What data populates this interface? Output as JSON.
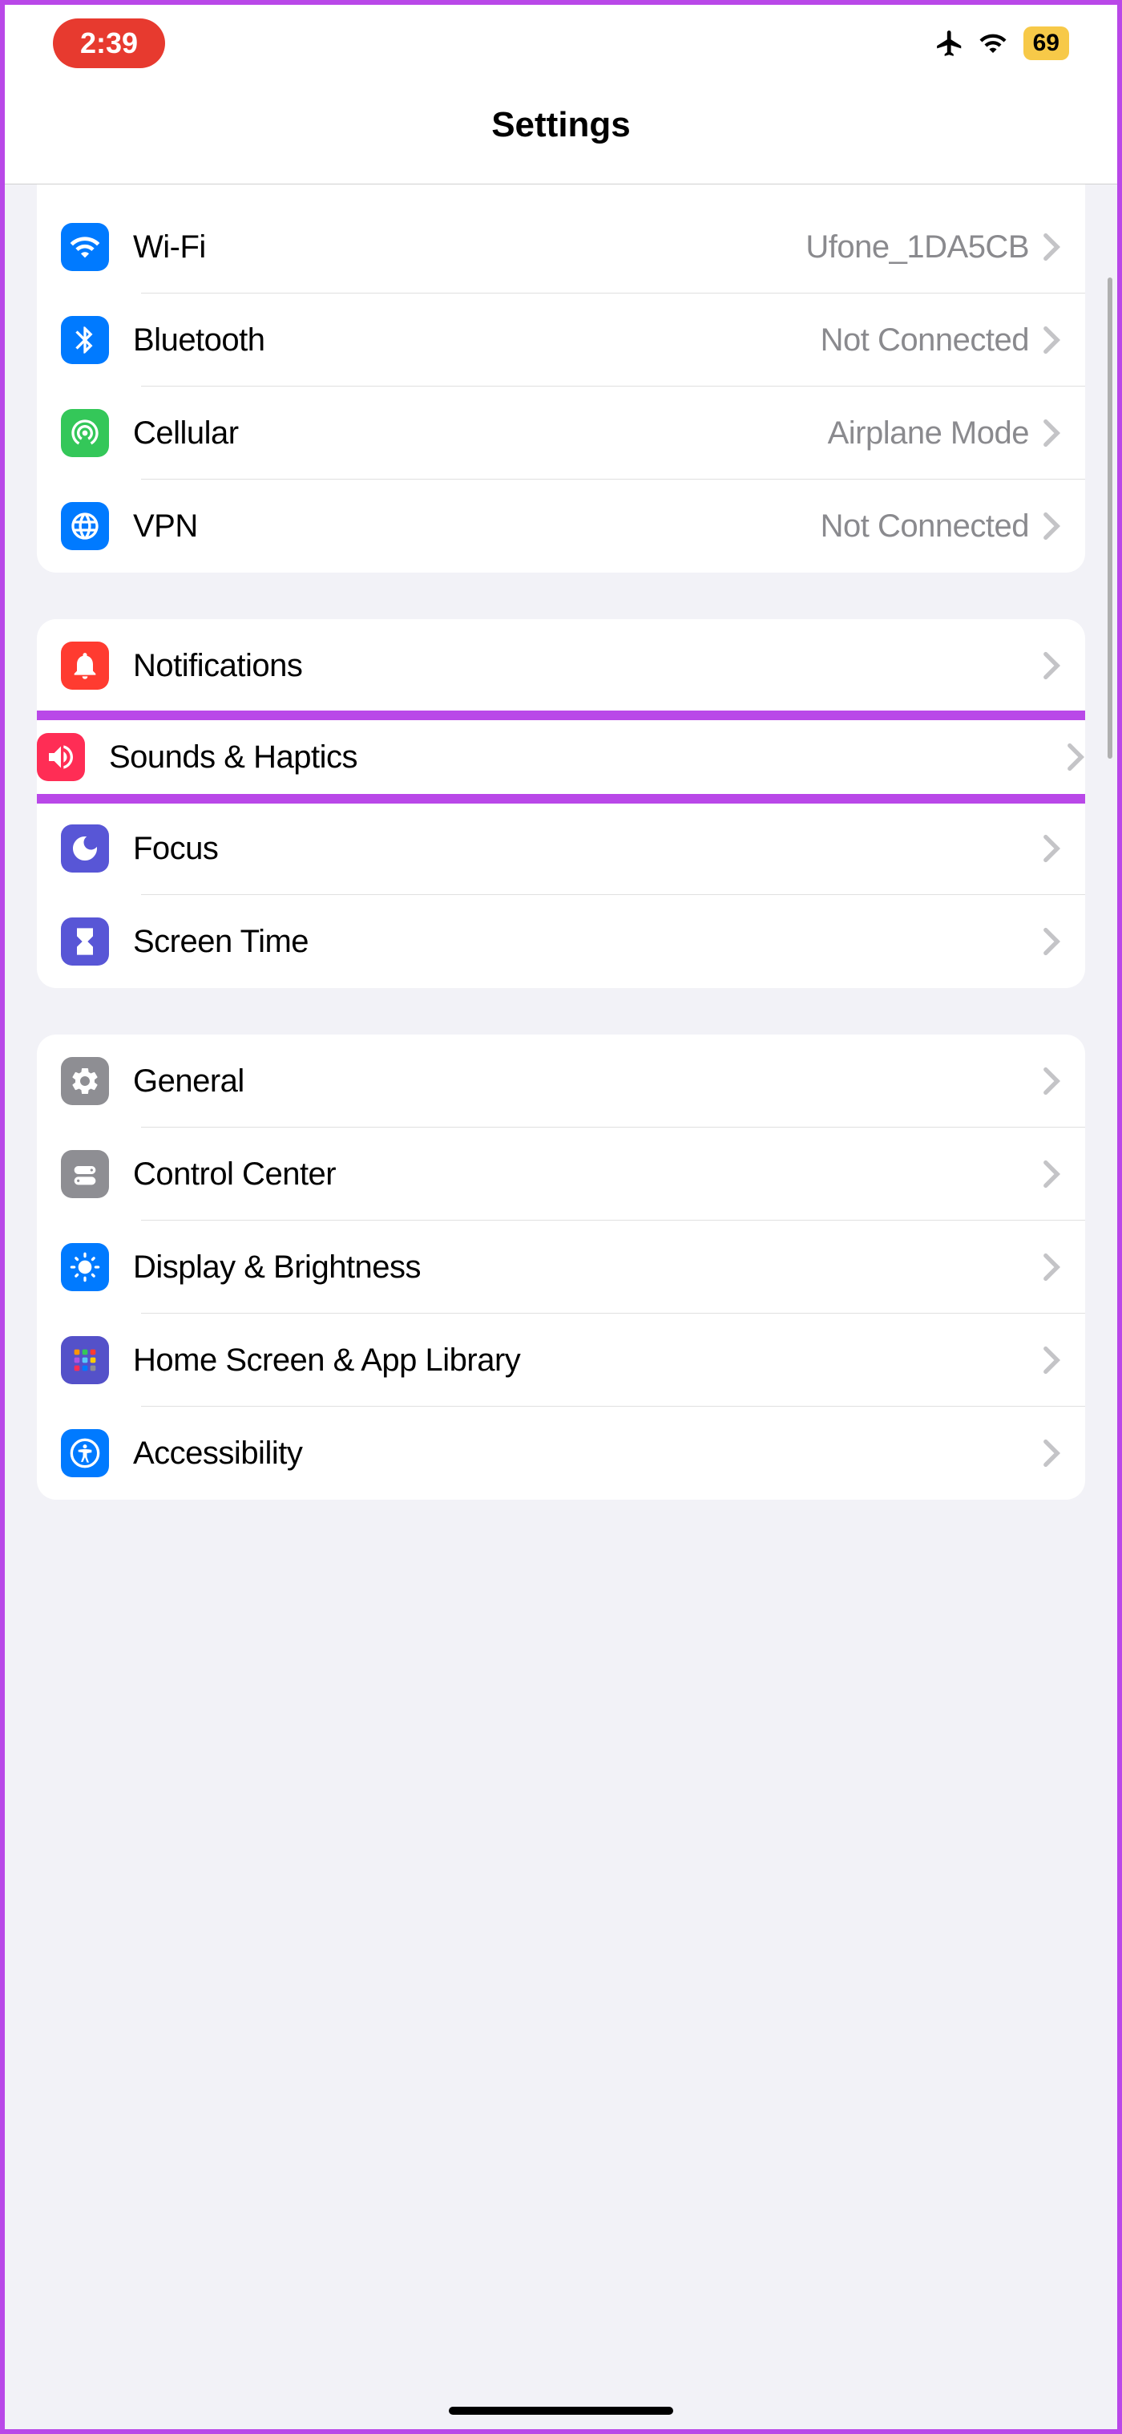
{
  "status": {
    "time": "2:39",
    "battery": "69"
  },
  "header": {
    "title": "Settings"
  },
  "sections": [
    {
      "rows": [
        {
          "id": "wifi",
          "label": "Wi-Fi",
          "value": "Ufone_1DA5CB",
          "color": "#007aff",
          "icon": "wifi"
        },
        {
          "id": "bluetooth",
          "label": "Bluetooth",
          "value": "Not Connected",
          "color": "#007aff",
          "icon": "bluetooth"
        },
        {
          "id": "cellular",
          "label": "Cellular",
          "value": "Airplane Mode",
          "color": "#34c759",
          "icon": "antenna"
        },
        {
          "id": "vpn",
          "label": "VPN",
          "value": "Not Connected",
          "color": "#007aff",
          "icon": "globe"
        }
      ]
    },
    {
      "rows": [
        {
          "id": "notifications",
          "label": "Notifications",
          "value": "",
          "color": "#ff3b30",
          "icon": "bell"
        },
        {
          "id": "sounds",
          "label": "Sounds & Haptics",
          "value": "",
          "color": "#ff2d55",
          "icon": "speaker",
          "highlighted": true
        },
        {
          "id": "focus",
          "label": "Focus",
          "value": "",
          "color": "#5856d6",
          "icon": "moon"
        },
        {
          "id": "screentime",
          "label": "Screen Time",
          "value": "",
          "color": "#5856d6",
          "icon": "hourglass"
        }
      ]
    },
    {
      "rows": [
        {
          "id": "general",
          "label": "General",
          "value": "",
          "color": "#8e8e93",
          "icon": "gear"
        },
        {
          "id": "controlcenter",
          "label": "Control Center",
          "value": "",
          "color": "#8e8e93",
          "icon": "switches"
        },
        {
          "id": "display",
          "label": "Display & Brightness",
          "value": "",
          "color": "#007aff",
          "icon": "sun"
        },
        {
          "id": "homescreen",
          "label": "Home Screen & App Library",
          "value": "",
          "color": "#5451c9",
          "icon": "grid"
        },
        {
          "id": "accessibility",
          "label": "Accessibility",
          "value": "",
          "color": "#007aff",
          "icon": "accessibility"
        }
      ]
    }
  ]
}
